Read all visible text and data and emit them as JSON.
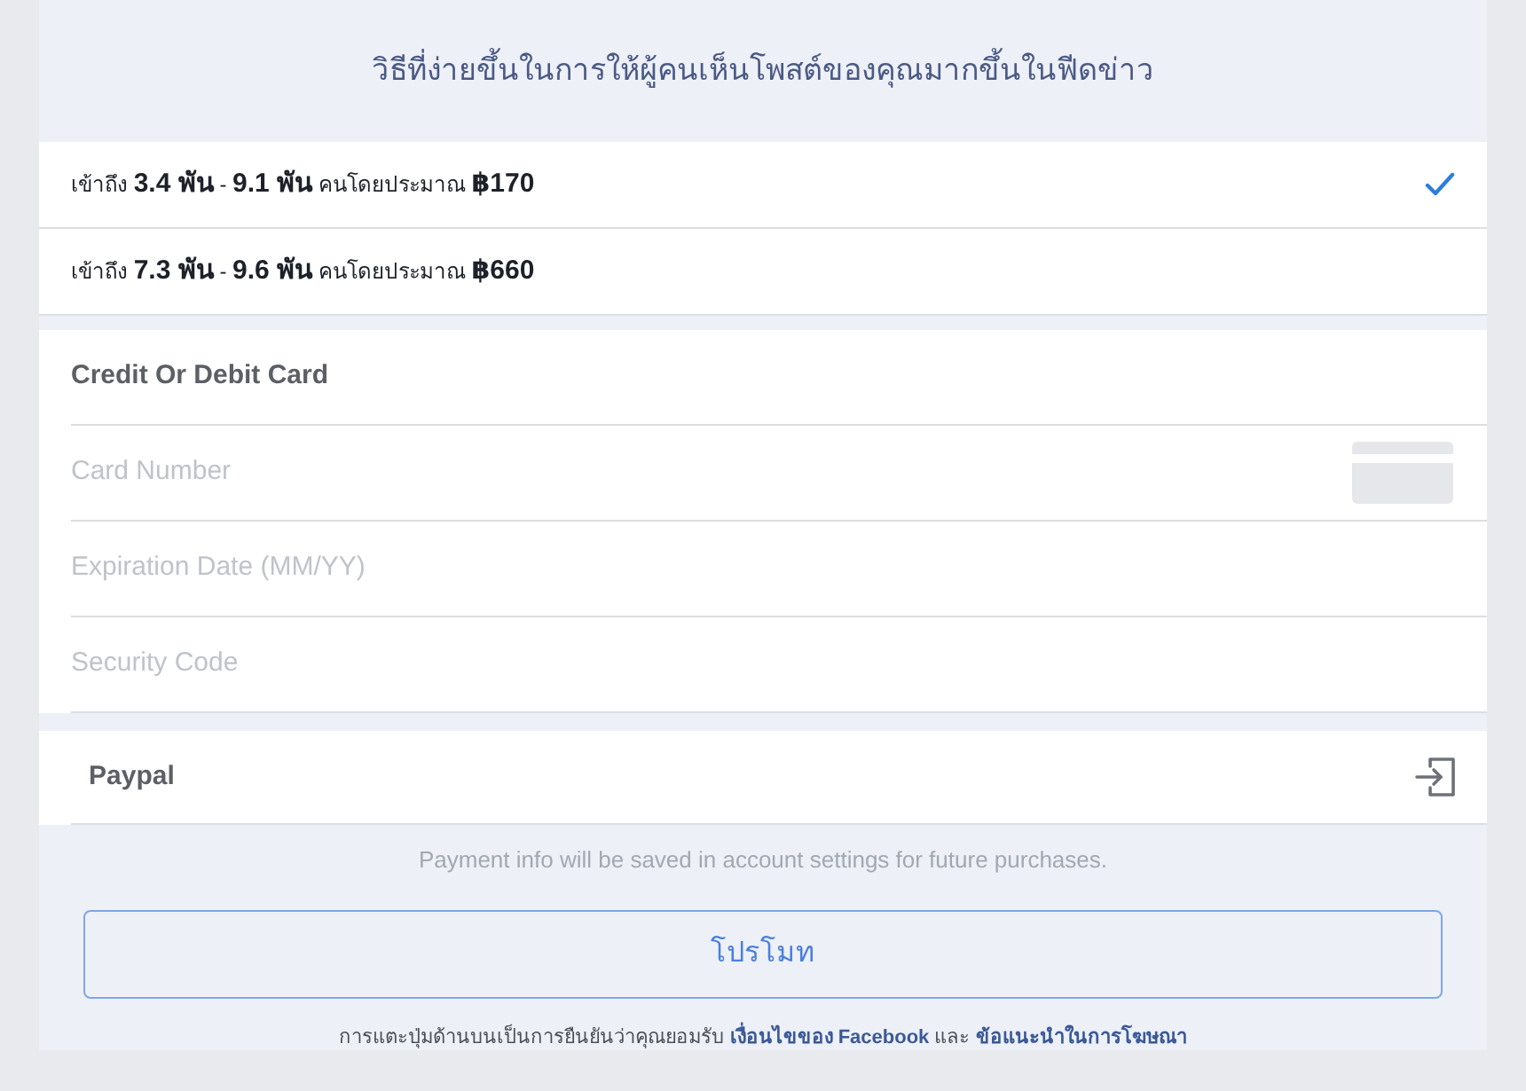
{
  "header": {
    "title": "วิธีที่ง่ายขึ้นในการให้ผู้คนเห็นโพสต์ของคุณมากขึ้นในฟีดข่าว"
  },
  "audience_options": [
    {
      "text": "เข้าถึง **3.4 พัน** - **9.1 พัน** คนโดยประมาณ **฿170**",
      "selected": true
    },
    {
      "text": "เข้าถึง **7.3 พัน** - **9.6 พัน** คนโดยประมาณ **฿660**",
      "selected": false
    }
  ],
  "card_section": {
    "title": "Credit Or Debit Card",
    "fields": [
      {
        "kind": "card",
        "placeholder": "Card Number"
      },
      {
        "kind": "plain",
        "placeholder": "Expiration Date (MM/YY)"
      },
      {
        "kind": "plain",
        "placeholder": "Security Code"
      }
    ]
  },
  "paypal": {
    "label": "Paypal"
  },
  "note": "Payment info will be saved in account settings for future purchases.",
  "promote_button": {
    "label": "โปรโมท"
  },
  "terms": {
    "text": "การแตะปุ่มด้านบนเป็นการยืนยันว่าคุณยอมรับ",
    "link_1": "เงื่อนไขของ Facebook",
    "joiner": "และ",
    "link_2": "ข้อแนะนำในการโฆษณา"
  }
}
